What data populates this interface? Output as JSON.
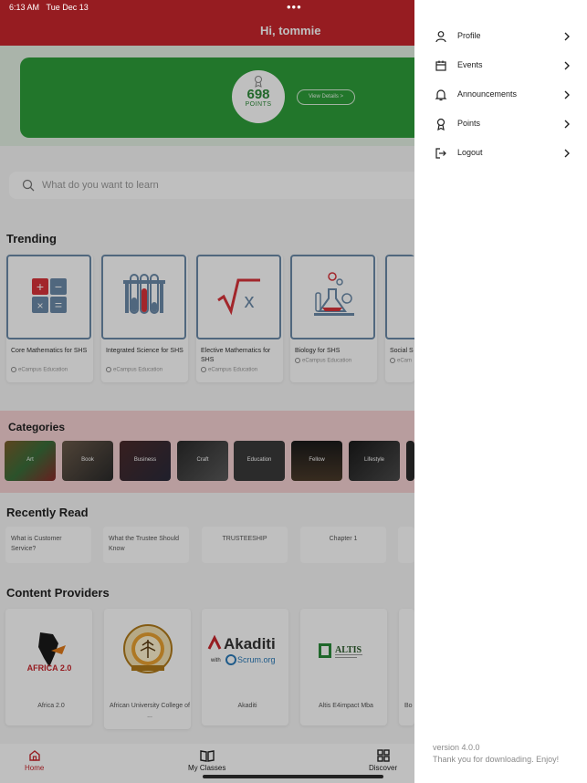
{
  "status_bar": {
    "time": "6:13 AM",
    "date": "Tue Dec 13",
    "dots": "•••"
  },
  "header": {
    "greeting": "Hi, tommie"
  },
  "points_banner": {
    "points": "698",
    "points_label": "POINTS",
    "view_details": "View Details >"
  },
  "search": {
    "placeholder": "What do you want to learn"
  },
  "trending": {
    "title": "Trending",
    "cards": [
      {
        "title": "Core Mathematics for SHS",
        "provider": "eCampus Education",
        "icon": "calculator-icon"
      },
      {
        "title": "Integrated Science for SHS",
        "provider": "eCampus Education",
        "icon": "test-tubes-icon"
      },
      {
        "title": "Elective Mathematics for SHS",
        "provider": "eCampus Education",
        "icon": "square-root-icon"
      },
      {
        "title": "Biology for SHS",
        "provider": "eCampus Education",
        "icon": "lab-flask-icon"
      },
      {
        "title": "Social S",
        "provider": "eCam",
        "icon": "book-icon"
      }
    ]
  },
  "categories": {
    "title": "Categories",
    "items": [
      "Art",
      "Book",
      "Business",
      "Craft",
      "Education",
      "Fellow",
      "Lifestyle"
    ]
  },
  "recently_read": {
    "title": "Recently Read",
    "items": [
      "What is Customer Service?",
      "What the Trustee Should Know",
      "TRUSTEESHIP",
      "Chapter 1"
    ]
  },
  "content_providers": {
    "title": "Content Providers",
    "items": [
      {
        "name": "Africa 2.0",
        "logo_text": "AFRICA 2.0"
      },
      {
        "name": "African University College of ...",
        "logo_text": ""
      },
      {
        "name": "Akaditi",
        "logo_text": "Akaditi",
        "logo_sub": "Scrum.org"
      },
      {
        "name": "Altis E4impact Mba",
        "logo_text": "ALTIS"
      },
      {
        "name": "Bo",
        "logo_text": ""
      }
    ]
  },
  "bottom_nav": {
    "home": "Home",
    "classes": "My Classes",
    "discover": "Discover"
  },
  "drawer": {
    "items": [
      {
        "label": "Profile",
        "icon": "person-icon"
      },
      {
        "label": "Events",
        "icon": "calendar-icon"
      },
      {
        "label": "Announcements",
        "icon": "bell-icon"
      },
      {
        "label": "Points",
        "icon": "award-icon"
      },
      {
        "label": "Logout",
        "icon": "logout-icon"
      }
    ],
    "version": "version 4.0.0",
    "thanks": "Thank you for downloading. Enjoy!"
  },
  "colors": {
    "brand_red": "#c9262d",
    "banner_green": "#2e9e3a",
    "category_bg": "#f6d2d3"
  }
}
